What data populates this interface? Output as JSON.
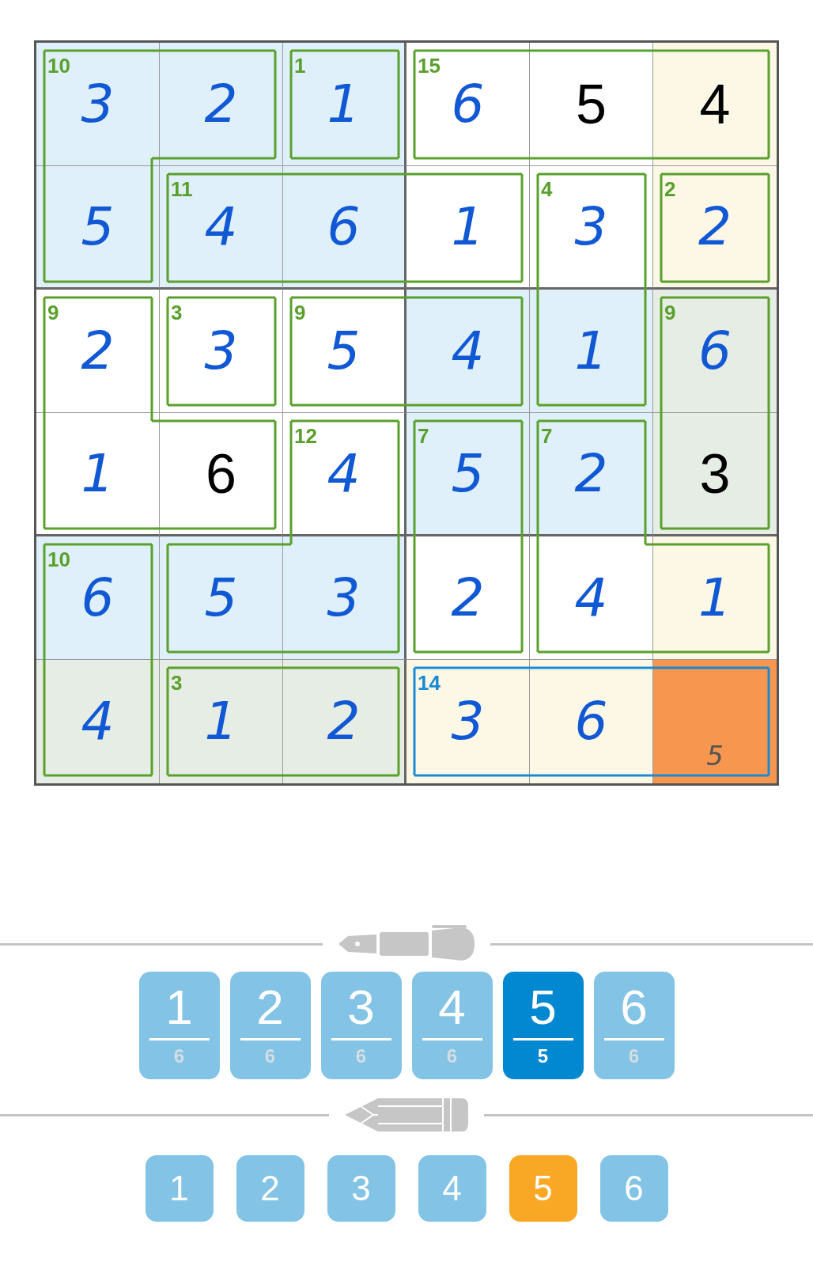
{
  "grid": {
    "rows": [
      {
        "cells": [
          {
            "value": "3",
            "kind": "entered",
            "color": "#dff0fb",
            "sum": "10",
            "joins_right": true,
            "joins_down": true,
            "cage_selected": false
          },
          {
            "value": "2",
            "kind": "entered",
            "color": "#dff0fb",
            "joins_right": false,
            "joins_down": false,
            "cage_selected": false
          },
          {
            "value": "1",
            "kind": "entered",
            "color": "#dff0fb",
            "sum": "1",
            "joins_right": false,
            "joins_down": false,
            "cage_selected": false
          },
          {
            "value": "6",
            "kind": "entered",
            "color": "#ffffff",
            "sum": "15",
            "joins_right": true,
            "joins_down": false,
            "cage_selected": false
          },
          {
            "value": "5",
            "kind": "given",
            "color": "#ffffff",
            "joins_right": true,
            "joins_down": false,
            "cage_selected": false
          },
          {
            "value": "4",
            "kind": "given",
            "color": "#fdf8e6",
            "joins_down": false,
            "cage_selected": false
          }
        ]
      },
      {
        "cells": [
          {
            "value": "5",
            "kind": "entered",
            "color": "#dff0fb",
            "joins_right": false,
            "joins_down": false,
            "cage_selected": false
          },
          {
            "value": "4",
            "kind": "entered",
            "color": "#dff0fb",
            "sum": "11",
            "joins_right": true,
            "joins_down": false,
            "cage_selected": false
          },
          {
            "value": "6",
            "kind": "entered",
            "color": "#dff0fb",
            "joins_right": true,
            "joins_down": false,
            "cage_selected": false
          },
          {
            "value": "1",
            "kind": "entered",
            "color": "#ffffff",
            "joins_right": false,
            "joins_down": false,
            "cage_selected": false
          },
          {
            "value": "3",
            "kind": "entered",
            "color": "#ffffff",
            "sum": "4",
            "joins_right": false,
            "joins_down": true,
            "cage_selected": false
          },
          {
            "value": "2",
            "kind": "entered",
            "color": "#fdf8e6",
            "sum": "2",
            "joins_down": false,
            "cage_selected": false
          }
        ]
      },
      {
        "cells": [
          {
            "value": "2",
            "kind": "entered",
            "color": "#ffffff",
            "sum": "9",
            "joins_right": false,
            "joins_down": true,
            "cage_selected": false
          },
          {
            "value": "3",
            "kind": "entered",
            "color": "#ffffff",
            "sum": "3",
            "joins_right": false,
            "joins_down": false,
            "cage_selected": false
          },
          {
            "value": "5",
            "kind": "entered",
            "color": "#ffffff",
            "sum": "9",
            "joins_right": true,
            "joins_down": false,
            "cage_selected": false
          },
          {
            "value": "4",
            "kind": "entered",
            "color": "#dff0fb",
            "joins_right": false,
            "joins_down": false,
            "cage_selected": false
          },
          {
            "value": "1",
            "kind": "entered",
            "color": "#dff0fb",
            "joins_right": false,
            "joins_down": false,
            "cage_selected": false
          },
          {
            "value": "6",
            "kind": "entered",
            "color": "#e6ede4",
            "sum": "9",
            "joins_down": true,
            "cage_selected": false
          }
        ]
      },
      {
        "cells": [
          {
            "value": "1",
            "kind": "entered",
            "color": "#ffffff",
            "joins_right": true,
            "joins_down": false,
            "cage_selected": false
          },
          {
            "value": "6",
            "kind": "given",
            "color": "#ffffff",
            "joins_right": false,
            "joins_down": false,
            "cage_selected": false
          },
          {
            "value": "4",
            "kind": "entered",
            "color": "#ffffff",
            "sum": "12",
            "joins_right": false,
            "joins_down": true,
            "cage_selected": false
          },
          {
            "value": "5",
            "kind": "entered",
            "color": "#dff0fb",
            "sum": "7",
            "joins_right": false,
            "joins_down": true,
            "cage_selected": false
          },
          {
            "value": "2",
            "kind": "entered",
            "color": "#dff0fb",
            "sum": "7",
            "joins_right": false,
            "joins_down": true,
            "cage_selected": false
          },
          {
            "value": "3",
            "kind": "given",
            "color": "#e6ede4",
            "joins_down": false,
            "cage_selected": false
          }
        ]
      },
      {
        "cells": [
          {
            "value": "6",
            "kind": "entered",
            "color": "#dff0fb",
            "sum": "10",
            "joins_right": false,
            "joins_down": true,
            "cage_selected": false
          },
          {
            "value": "5",
            "kind": "entered",
            "color": "#dff0fb",
            "joins_right": true,
            "joins_down": false,
            "cage_selected": false
          },
          {
            "value": "3",
            "kind": "entered",
            "color": "#dff0fb",
            "joins_right": false,
            "joins_down": false,
            "cage_selected": false
          },
          {
            "value": "2",
            "kind": "entered",
            "color": "#ffffff",
            "joins_right": false,
            "joins_down": false,
            "cage_selected": false
          },
          {
            "value": "4",
            "kind": "entered",
            "color": "#ffffff",
            "joins_right": true,
            "joins_down": false,
            "cage_selected": false
          },
          {
            "value": "1",
            "kind": "entered",
            "color": "#fdf8e6",
            "joins_down": false,
            "cage_selected": false
          }
        ]
      },
      {
        "cells": [
          {
            "value": "4",
            "kind": "entered",
            "color": "#e6ede4",
            "joins_right": false,
            "cage_selected": false
          },
          {
            "value": "1",
            "kind": "entered",
            "color": "#e6ede4",
            "sum": "3",
            "joins_right": true,
            "cage_selected": false
          },
          {
            "value": "2",
            "kind": "entered",
            "color": "#e6ede4",
            "joins_right": false,
            "cage_selected": false
          },
          {
            "value": "3",
            "kind": "entered",
            "color": "#fdf8e6",
            "sum": "14",
            "joins_right": true,
            "cage_selected": true
          },
          {
            "value": "6",
            "kind": "entered",
            "color": "#fdf8e6",
            "joins_right": true,
            "cage_selected": true
          },
          {
            "value": "5",
            "kind": "pencil",
            "color": "#f7964f",
            "cage_selected": true
          }
        ]
      }
    ]
  },
  "pen_digits": [
    {
      "digit": "1",
      "count": "6",
      "selected": false
    },
    {
      "digit": "2",
      "count": "6",
      "selected": false
    },
    {
      "digit": "3",
      "count": "6",
      "selected": false
    },
    {
      "digit": "4",
      "count": "6",
      "selected": false
    },
    {
      "digit": "5",
      "count": "5",
      "selected": true
    },
    {
      "digit": "6",
      "count": "6",
      "selected": false
    }
  ],
  "pencil_digits": [
    {
      "digit": "1",
      "selected": false
    },
    {
      "digit": "2",
      "selected": false
    },
    {
      "digit": "3",
      "selected": false
    },
    {
      "digit": "4",
      "selected": false
    },
    {
      "digit": "5",
      "selected": true
    },
    {
      "digit": "6",
      "selected": false
    }
  ]
}
